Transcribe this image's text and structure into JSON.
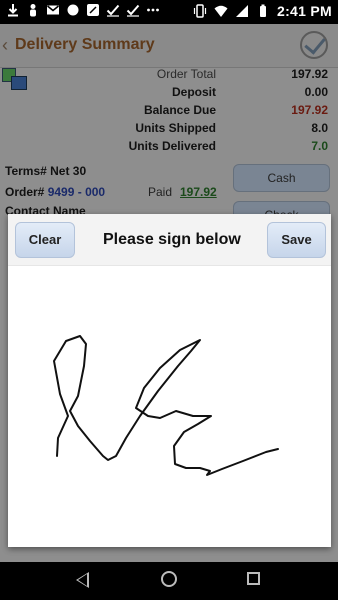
{
  "status_bar": {
    "time": "2:41 PM",
    "left_icons": [
      "download-icon",
      "person-icon",
      "gmail-icon",
      "circle-icon",
      "maps-icon",
      "check-icon",
      "check-icon",
      "more-icon"
    ],
    "right_icons": [
      "vibrate-icon",
      "wifi-icon",
      "signal-icon",
      "battery-icon"
    ]
  },
  "app": {
    "title": "Delivery Summary",
    "summary": [
      {
        "label": "Order Total",
        "value": "197.92"
      },
      {
        "label": "Deposit",
        "value": "0.00"
      },
      {
        "label": "Balance Due",
        "value": "197.92"
      },
      {
        "label": "Units Shipped",
        "value": "8.0"
      },
      {
        "label": "Units Delivered",
        "value": "7.0"
      }
    ],
    "terms": "Terms# Net 30",
    "order_label": "Order#",
    "order_number": "9499 - 000",
    "paid_label": "Paid",
    "paid_value": "197.92",
    "contact_label": "Contact Name",
    "cash_button": "Cash",
    "check_button": "Check"
  },
  "dialog": {
    "title": "Please sign below",
    "clear_label": "Clear",
    "save_label": "Save"
  },
  "colors": {
    "overlay": "#7f7f7f",
    "dialog_button": "#d4e0f0",
    "title_brown": "#5f3a1a",
    "balance_red": "#6a1a10",
    "delivered_green": "#1a4a1a",
    "order_blue": "#1a2a6a"
  }
}
